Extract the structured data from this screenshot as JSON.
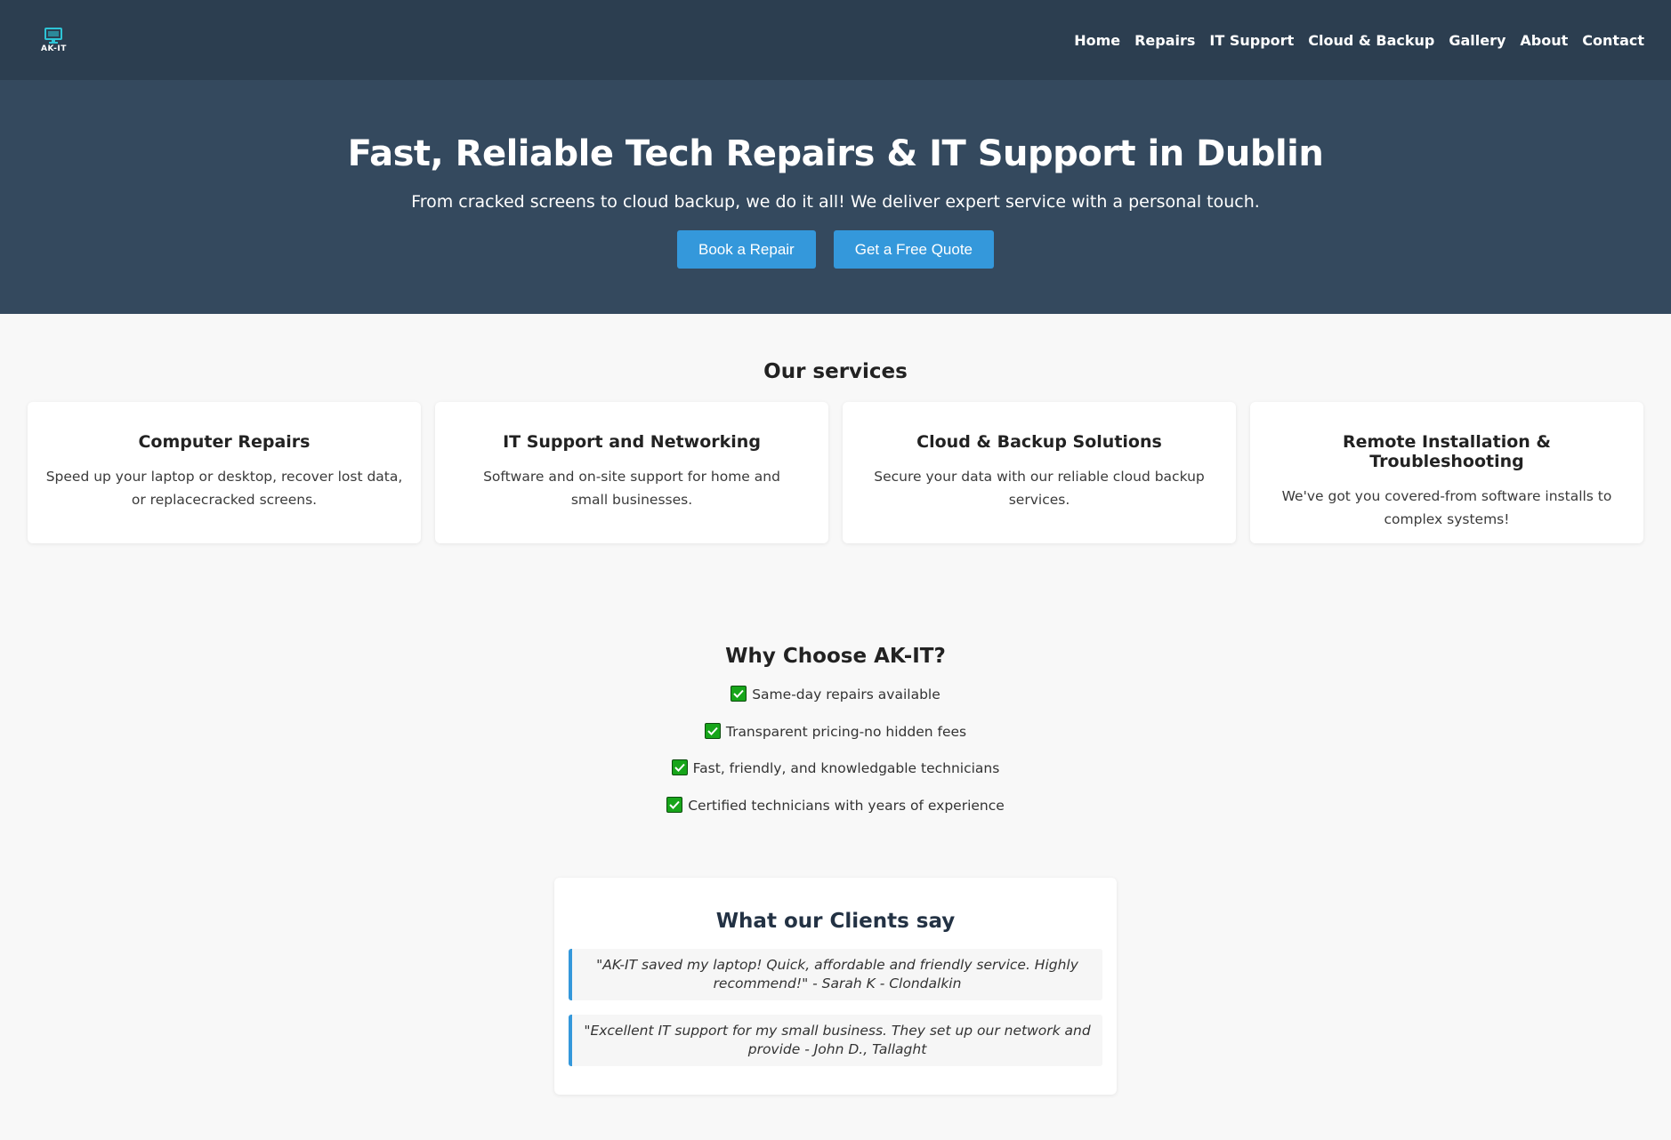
{
  "brand": {
    "logo_text": "AK-IT",
    "logo_icon": "monitor-icon"
  },
  "nav": {
    "items": [
      {
        "label": "Home"
      },
      {
        "label": "Repairs"
      },
      {
        "label": "IT Support"
      },
      {
        "label": "Cloud & Backup"
      },
      {
        "label": "Gallery"
      },
      {
        "label": "About"
      },
      {
        "label": "Contact"
      }
    ]
  },
  "hero": {
    "title": "Fast, Reliable Tech Repairs & IT Support in Dublin",
    "subtitle": "From cracked screens to cloud backup, we do it all! We deliver expert service with a personal touch.",
    "primary_button": "Book a Repair",
    "secondary_button": "Get a Free Quote"
  },
  "services": {
    "title": "Our services",
    "cards": [
      {
        "title": "Computer Repairs",
        "description": "Speed up your laptop or desktop, recover lost data, or replacecracked screens."
      },
      {
        "title": "IT Support and Networking",
        "description": "Software and on-site support for home and small businesses."
      },
      {
        "title": "Cloud & Backup Solutions",
        "description": "Secure your data with our reliable cloud backup services."
      },
      {
        "title": "Remote Installation & Troubleshooting",
        "description": "We've got you covered-from software installs to complex systems!"
      }
    ]
  },
  "why": {
    "title": "Why Choose AK-IT?",
    "items": [
      "Same-day repairs available",
      "Transparent pricing-no hidden fees",
      "Fast, friendly, and knowledgable technicians",
      "Certified technicians with years of experience"
    ]
  },
  "testimonials": {
    "title": "What our Clients say",
    "quotes": [
      "\"AK-IT saved my laptop! Quick, affordable and friendly service. Highly recommend!\" - Sarah K - Clondalkin",
      "\"Excellent IT support for my small business. They set up our network and provide - John D., Tallaght"
    ]
  },
  "colors": {
    "nav_bg": "#2c3e50",
    "hero_bg": "#34495e",
    "accent": "#3498db",
    "page_bg": "#f8f8f8",
    "check_green": "#17a51a"
  }
}
